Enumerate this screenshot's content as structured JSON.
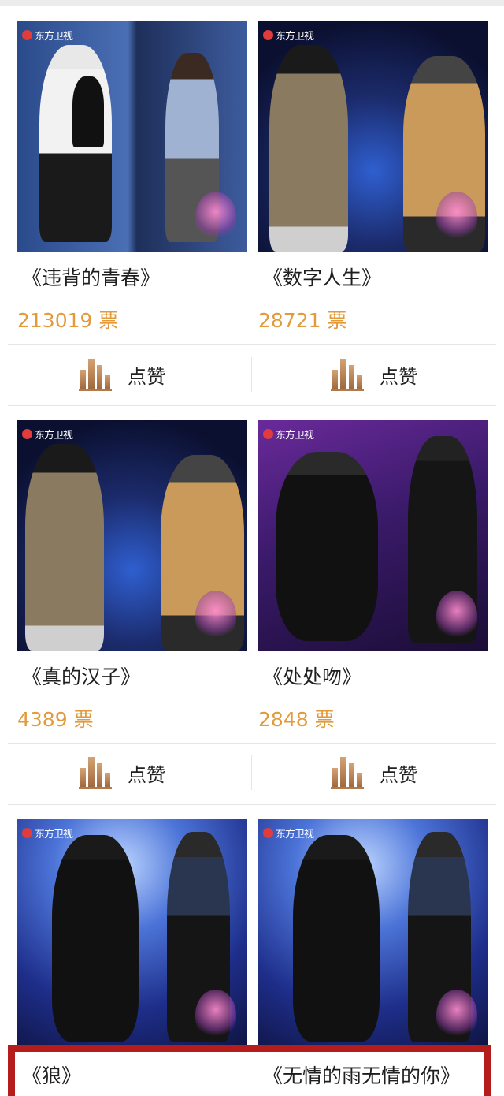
{
  "channel_logo": "东方卫视",
  "like_label": "点赞",
  "vote_unit": "票",
  "cards": [
    {
      "title": "《违背的青春》",
      "votes": "213019"
    },
    {
      "title": "《数字人生》",
      "votes": "28721"
    },
    {
      "title": "《真的汉子》",
      "votes": "4389"
    },
    {
      "title": "《处处吻》",
      "votes": "2848"
    },
    {
      "title": "《狼》",
      "votes": ""
    },
    {
      "title": "《无情的雨无情的你》",
      "votes": ""
    }
  ],
  "icons": {
    "like": "bar-chart-icon",
    "logo": "tv-channel-logo-icon"
  },
  "colors": {
    "votes": "#e29a3b",
    "accent_bar": "#b51d1d",
    "title": "#1e1e1e"
  }
}
